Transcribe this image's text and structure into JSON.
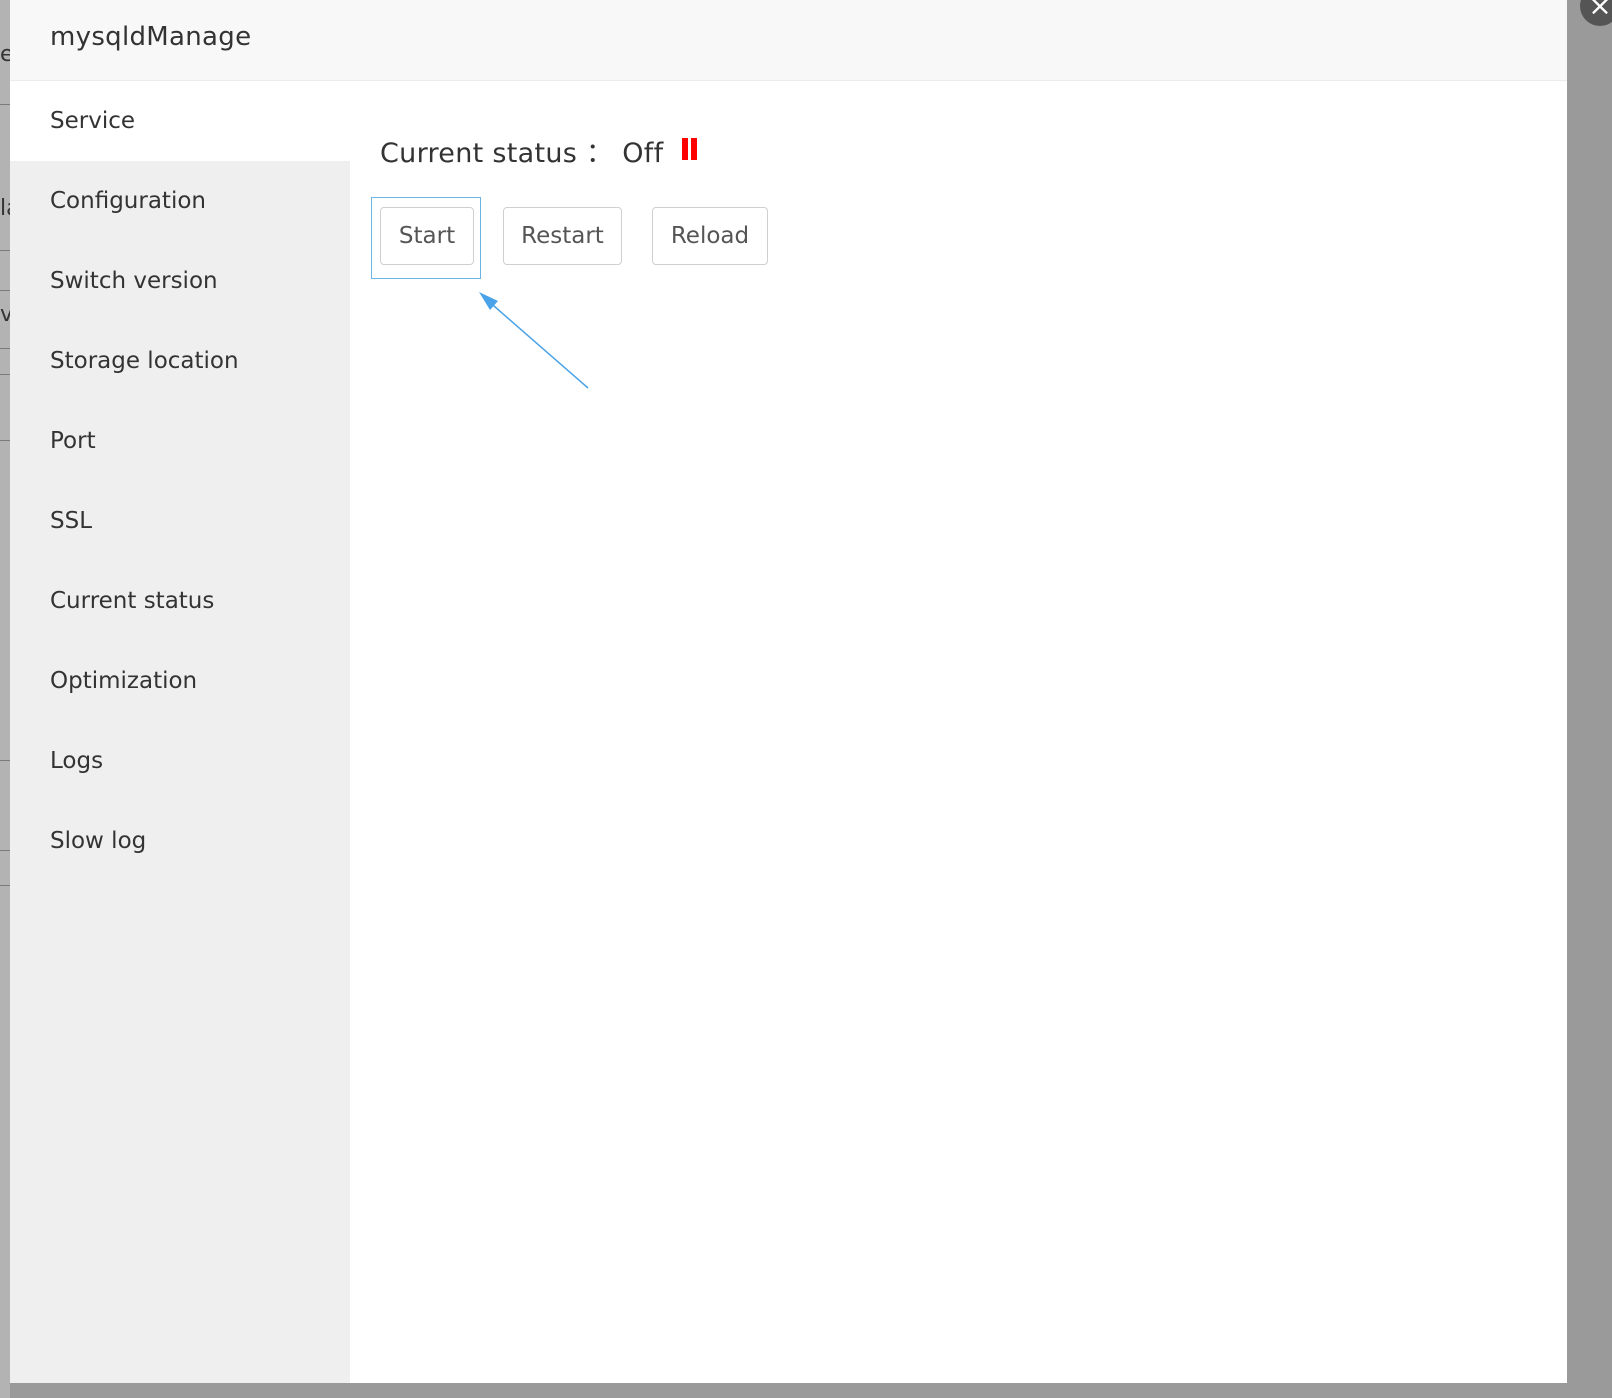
{
  "modal": {
    "title": "mysqldManage",
    "close_glyph": "×"
  },
  "background_peek": {
    "chars": [
      "e",
      "la",
      "v"
    ]
  },
  "sidebar": {
    "items": [
      {
        "label": "Service",
        "active": true
      },
      {
        "label": "Configuration",
        "active": false
      },
      {
        "label": "Switch version",
        "active": false
      },
      {
        "label": "Storage location",
        "active": false
      },
      {
        "label": "Port",
        "active": false
      },
      {
        "label": "SSL",
        "active": false
      },
      {
        "label": "Current status",
        "active": false
      },
      {
        "label": "Optimization",
        "active": false
      },
      {
        "label": "Logs",
        "active": false
      },
      {
        "label": "Slow log",
        "active": false
      }
    ]
  },
  "service": {
    "status_label": "Current status",
    "status_separator": "：",
    "status_value": "Off",
    "status_icon": "pause-icon",
    "status_color": "#ff0000",
    "buttons": {
      "start": "Start",
      "restart": "Restart",
      "reload": "Reload"
    },
    "annotation_color": "#4aa3e8"
  }
}
